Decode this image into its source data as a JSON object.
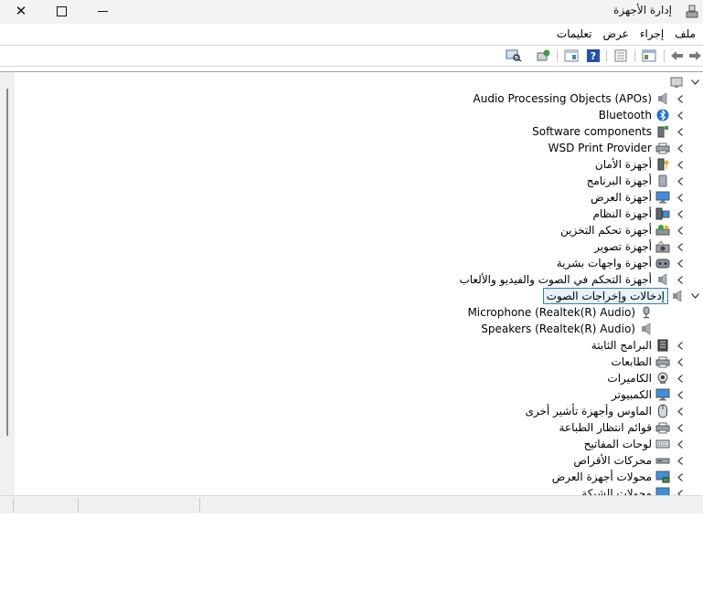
{
  "window": {
    "title": "إدارة الأجهزة"
  },
  "menu": [
    "ملف",
    "إجراء",
    "عرض",
    "تعليمات"
  ],
  "toolbar": [
    "back-arrow-icon",
    "forward-arrow-icon",
    "properties-icon",
    "list-view-icon",
    "help-icon",
    "device-details-icon",
    "update-driver-icon",
    "scan-hardware-icon"
  ],
  "tree": {
    "root_icon": "computer-icon",
    "items": [
      {
        "label": "Audio Processing Objects (APOs)",
        "icon": "speaker-icon",
        "rtl": false
      },
      {
        "label": "Bluetooth",
        "icon": "bluetooth-icon",
        "rtl": false
      },
      {
        "label": "Software components",
        "icon": "software-component-icon",
        "rtl": false
      },
      {
        "label": "WSD Print Provider",
        "icon": "printer-icon",
        "rtl": false
      },
      {
        "label": "أجهزة الأمان",
        "icon": "security-key-icon",
        "rtl": true
      },
      {
        "label": "أجهزة البرنامج",
        "icon": "software-device-icon",
        "rtl": true
      },
      {
        "label": "أجهزة العرض",
        "icon": "monitor-icon",
        "rtl": true
      },
      {
        "label": "أجهزة النظام",
        "icon": "system-device-icon",
        "rtl": true
      },
      {
        "label": "أجهزة تحكم التخزين",
        "icon": "storage-controller-icon",
        "rtl": true
      },
      {
        "label": "أجهزة تصوير",
        "icon": "imaging-device-icon",
        "rtl": true
      },
      {
        "label": "أجهزة واجهات بشرية",
        "icon": "hid-icon",
        "rtl": true
      },
      {
        "label": "أجهزة التحكم في الصوت والفيديو والألعاب",
        "icon": "speaker-icon",
        "rtl": true
      },
      {
        "label": "إدخالات وإخراجات الصوت",
        "icon": "speaker-icon",
        "rtl": true,
        "expanded": true,
        "selected": true
      },
      {
        "label": "Microphone (Realtek(R) Audio)",
        "icon": "microphone-icon",
        "rtl": false,
        "child": true
      },
      {
        "label": "Speakers (Realtek(R) Audio)",
        "icon": "speaker-icon",
        "rtl": false,
        "child": true
      },
      {
        "label": "البرامج الثابتة",
        "icon": "firmware-icon",
        "rtl": true
      },
      {
        "label": "الطابعات",
        "icon": "printer-icon",
        "rtl": true
      },
      {
        "label": "الكاميرات",
        "icon": "camera-icon",
        "rtl": true
      },
      {
        "label": "الكمبيوتر",
        "icon": "monitor-icon",
        "rtl": true
      },
      {
        "label": "الماوس وأجهزة تأشير أخرى",
        "icon": "mouse-icon",
        "rtl": true
      },
      {
        "label": "قوائم انتظار الطباعة",
        "icon": "printer-icon",
        "rtl": true
      },
      {
        "label": "لوحات المفاتيح",
        "icon": "keyboard-icon",
        "rtl": true
      },
      {
        "label": "محركات الأقراص",
        "icon": "disk-drive-icon",
        "rtl": true
      },
      {
        "label": "محولات أجهزة العرض",
        "icon": "display-adapter-icon",
        "rtl": true
      },
      {
        "label": "محولات الشبكة",
        "icon": "network-adapter-icon",
        "rtl": true
      }
    ]
  },
  "colors": {
    "selection_border": "#3c7fb1",
    "selection_fill": "#e5f1fb",
    "titlebar": "#f3f3f3"
  }
}
